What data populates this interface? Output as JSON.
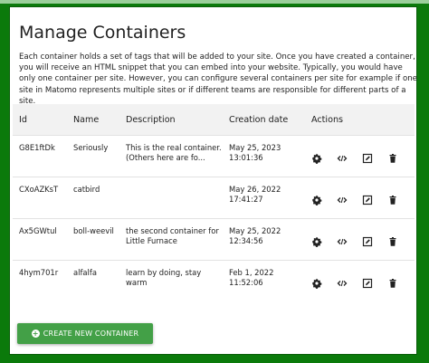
{
  "page": {
    "title": "Manage Containers",
    "description": "Each container holds a set of tags that will be added to your site. Once you have created a container, you will receive an HTML snippet that you can embed into your website. Typically, you would have only one container per site. However, you can configure several containers per site for example if one site in Matomo represents multiple sites or if different teams are responsible for different parts of a site."
  },
  "table": {
    "headers": {
      "id": "Id",
      "name": "Name",
      "description": "Description",
      "created": "Creation date",
      "actions": "Actions"
    },
    "rows": [
      {
        "id": "G8E1ftDk",
        "name": "Seriously",
        "description": "This is the real container. (Others here are fo...",
        "date": "May 25, 2023",
        "time": "13:01:36"
      },
      {
        "id": "CXoAZKsT",
        "name": "catbird",
        "description": "",
        "date": "May 26, 2022",
        "time": "17:41:27"
      },
      {
        "id": "Ax5GWtul",
        "name": "boll-weevil",
        "description": "the second container for Little Furnace",
        "date": "May 25, 2022",
        "time": "12:34:56"
      },
      {
        "id": "4hym701r",
        "name": "alfalfa",
        "description": "learn by doing, stay warm",
        "date": "Feb 1, 2022",
        "time": "11:52:06"
      }
    ],
    "action_icons": [
      "gear-icon",
      "code-icon",
      "edit-icon",
      "trash-icon"
    ]
  },
  "create_button": {
    "label": "CREATE NEW CONTAINER",
    "icon": "plus-circle-icon"
  },
  "colors": {
    "frame": "#0b7a0b",
    "button": "#43a047",
    "header_bg": "#f2f2f2"
  }
}
